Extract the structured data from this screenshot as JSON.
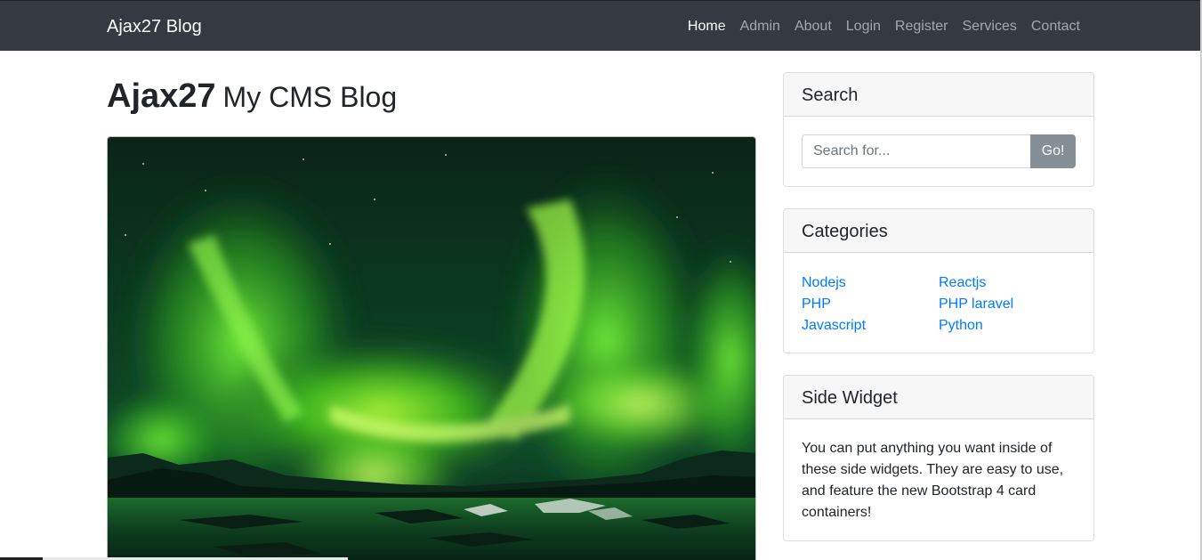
{
  "navbar": {
    "brand": "Ajax27 Blog",
    "items": [
      {
        "label": "Home",
        "active": true
      },
      {
        "label": "Admin",
        "active": false
      },
      {
        "label": "About",
        "active": false
      },
      {
        "label": "Login",
        "active": false
      },
      {
        "label": "Register",
        "active": false
      },
      {
        "label": "Services",
        "active": false
      },
      {
        "label": "Contact",
        "active": false
      }
    ]
  },
  "heading": {
    "title": "Ajax27",
    "subtitle": "My CMS Blog"
  },
  "search": {
    "title": "Search",
    "placeholder": "Search for...",
    "button_label": "Go!"
  },
  "categories": {
    "title": "Categories",
    "left": [
      "Nodejs",
      "PHP",
      "Javascript"
    ],
    "right": [
      "Reactjs",
      "PHP laravel",
      "Python"
    ]
  },
  "side_widget": {
    "title": "Side Widget",
    "text": "You can put anything you want inside of these side widgets. They are easy to use, and feature the new Bootstrap 4 card containers!"
  },
  "colors": {
    "navbar_bg": "#343a40",
    "link": "#007bff",
    "button_bg": "#868e96"
  }
}
